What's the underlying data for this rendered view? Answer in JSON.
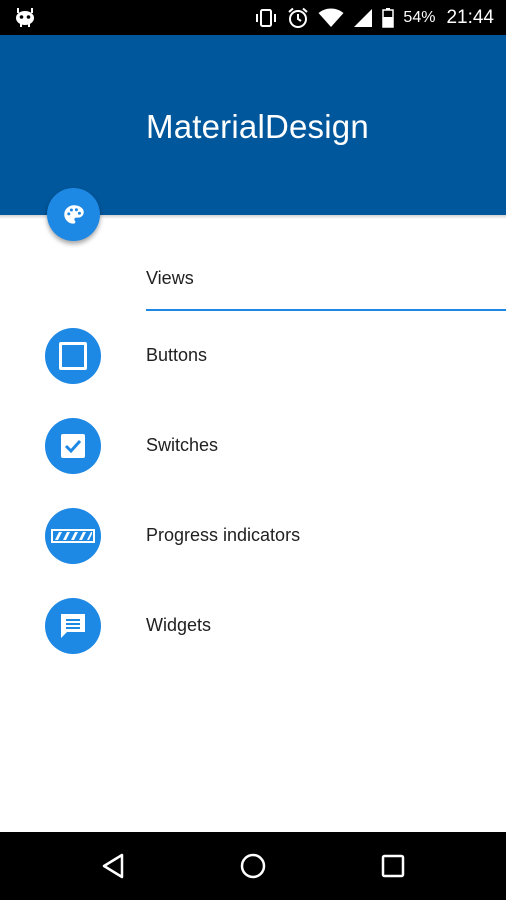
{
  "status_bar": {
    "battery_percent": "54%",
    "time": "21:44",
    "icons": [
      "debug-app-icon",
      "vibrate-icon",
      "alarm-icon",
      "wifi-icon",
      "signal-icon",
      "battery-icon"
    ]
  },
  "header": {
    "title": "MaterialDesign",
    "fab_icon": "palette-icon",
    "color": "#01579b"
  },
  "section": {
    "label": "Views"
  },
  "menu": {
    "accent_color": "#1e88e5",
    "items": [
      {
        "label": "Buttons",
        "icon": "square-icon"
      },
      {
        "label": "Switches",
        "icon": "checkbox-icon"
      },
      {
        "label": "Progress indicators",
        "icon": "progress-bar-icon"
      },
      {
        "label": "Widgets",
        "icon": "message-icon"
      }
    ]
  },
  "nav_bar": {
    "buttons": [
      "back-icon",
      "home-icon",
      "recents-icon"
    ]
  }
}
